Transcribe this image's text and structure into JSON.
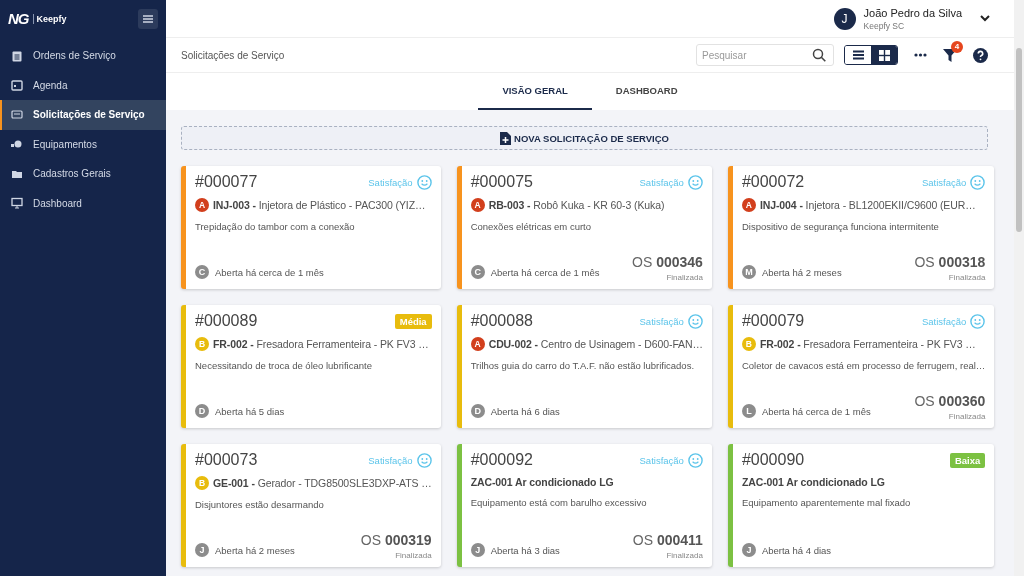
{
  "brand": {
    "logo": "NG",
    "name": "Keepfy"
  },
  "sidebar": {
    "items": [
      {
        "label": "Ordens de Serviço",
        "selected": false
      },
      {
        "label": "Agenda",
        "selected": false
      },
      {
        "label": "Solicitações de Serviço",
        "selected": true
      },
      {
        "label": "Equipamentos",
        "selected": false
      },
      {
        "label": "Cadastros Gerais",
        "selected": false
      },
      {
        "label": "Dashboard",
        "selected": false
      }
    ]
  },
  "user": {
    "initial": "J",
    "name": "João Pedro da Silva",
    "company": "Keepfy SC"
  },
  "breadcrumb": "Solicitações de Serviço",
  "search": {
    "placeholder": "Pesquisar"
  },
  "view_toggle": [
    {
      "kind": "list",
      "selected": false
    },
    {
      "kind": "grid",
      "selected": true
    }
  ],
  "filter_count": "4",
  "tabs": [
    {
      "label": "VISÃO GERAL",
      "selected": true
    },
    {
      "label": "DASHBOARD",
      "selected": false
    }
  ],
  "new_button": "NOVA SOLICITAÇÃO DE SERVIÇO",
  "cards": [
    {
      "number": "#000077",
      "color": "#f7931e",
      "top": {
        "kind": "satisfaction",
        "label": "Satisfação"
      },
      "class_badge": {
        "letter": "A",
        "color": "#d23f1c"
      },
      "equipment_code": "INJ-003 -",
      "equipment_name": "Injetora de Plástico - PAC300 (YIZ…",
      "description": "Trepidação do tambor com a conexão",
      "avatar": "C",
      "opened": "Aberta há cerca de 1 mês"
    },
    {
      "number": "#000075",
      "color": "#f7931e",
      "top": {
        "kind": "satisfaction",
        "label": "Satisfação"
      },
      "class_badge": {
        "letter": "A",
        "color": "#d23f1c"
      },
      "equipment_code": "RB-003 -",
      "equipment_name": "Robô Kuka - KR 60-3 (Kuka)",
      "description": "Conexões elétricas em curto",
      "avatar": "C",
      "opened": "Aberta há cerca de 1 mês",
      "os": {
        "prefix": "OS",
        "number": "000346",
        "status": "Finalizada"
      }
    },
    {
      "number": "#000072",
      "color": "#f7931e",
      "top": {
        "kind": "satisfaction",
        "label": "Satisfação"
      },
      "class_badge": {
        "letter": "A",
        "color": "#d23f1c"
      },
      "equipment_code": "INJ-004 -",
      "equipment_name": "Injetora - BL1200EKII/C9600 (EUR…",
      "description": "Dispositivo de segurança funciona intermitente",
      "avatar": "M",
      "opened": "Aberta há 2 meses",
      "os": {
        "prefix": "OS",
        "number": "000318",
        "status": "Finalizada"
      }
    },
    {
      "number": "#000089",
      "color": "#e8bc0d",
      "top": {
        "kind": "priority",
        "label": "Média",
        "color": "#e8bc0d"
      },
      "class_badge": {
        "letter": "B",
        "color": "#e8bc0d"
      },
      "equipment_code": "FR-002 -",
      "equipment_name": "Fresadora Ferramenteira - PK FV3 …",
      "description": "Necessitando de troca de óleo lubrificante",
      "avatar": "D",
      "opened": "Aberta há 5 dias"
    },
    {
      "number": "#000088",
      "color": "#e8bc0d",
      "top": {
        "kind": "satisfaction",
        "label": "Satisfação"
      },
      "class_badge": {
        "letter": "A",
        "color": "#d23f1c"
      },
      "equipment_code": "CDU-002 -",
      "equipment_name": "Centro de Usinagem - D600-FAN…",
      "description": "Trilhos guia do carro do T.A.F. não estão lubrificados.",
      "avatar": "D",
      "opened": "Aberta há 6 dias"
    },
    {
      "number": "#000079",
      "color": "#e8bc0d",
      "top": {
        "kind": "satisfaction",
        "label": "Satisfação"
      },
      "class_badge": {
        "letter": "B",
        "color": "#e8bc0d"
      },
      "equipment_code": "FR-002 -",
      "equipment_name": "Fresadora Ferramenteira - PK FV3 …",
      "description": "Coletor de cavacos está em processo de ferrugem, real…",
      "avatar": "L",
      "opened": "Aberta há cerca de 1 mês",
      "os": {
        "prefix": "OS",
        "number": "000360",
        "status": "Finalizada"
      }
    },
    {
      "number": "#000073",
      "color": "#e8bc0d",
      "top": {
        "kind": "satisfaction",
        "label": "Satisfação"
      },
      "class_badge": {
        "letter": "B",
        "color": "#e8bc0d"
      },
      "equipment_code": "GE-001 -",
      "equipment_name": "Gerador - TDG8500SLE3DXP-ATS …",
      "description": "Disjuntores estão desarmando",
      "avatar": "J",
      "opened": "Aberta há 2 meses",
      "os": {
        "prefix": "OS",
        "number": "000319",
        "status": "Finalizada"
      }
    },
    {
      "number": "#000092",
      "color": "#7cc142",
      "top": {
        "kind": "satisfaction",
        "label": "Satisfação"
      },
      "equipment_code": "ZAC-001 Ar condicionado LG",
      "description": "Equipamento está com barulho excessivo",
      "avatar": "J",
      "opened": "Aberta há 3 dias",
      "os": {
        "prefix": "OS",
        "number": "000411",
        "status": "Finalizada"
      }
    },
    {
      "number": "#000090",
      "color": "#7cc142",
      "top": {
        "kind": "priority",
        "label": "Baixa",
        "color": "#7cc142"
      },
      "equipment_code": "ZAC-001 Ar condicionado LG",
      "description": "Equipamento aparentemente mal fixado",
      "avatar": "J",
      "opened": "Aberta há 4 dias"
    }
  ]
}
